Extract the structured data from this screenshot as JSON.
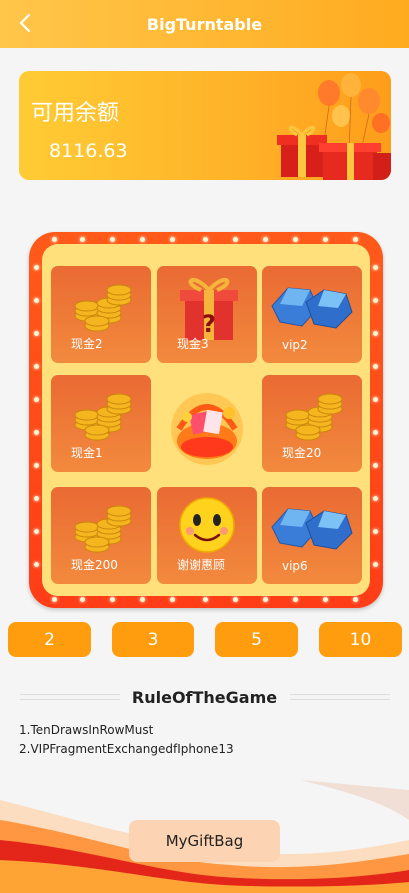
{
  "header": {
    "title": "BigTurntable",
    "back_icon": "chevron-left-icon"
  },
  "balance": {
    "label": "可用余额",
    "value": "8116.63"
  },
  "prizes": [
    {
      "label": "现金2",
      "icon": "gold-coins-icon"
    },
    {
      "label": "现金3",
      "icon": "mystery-gift-icon"
    },
    {
      "label": "vip2",
      "icon": "blue-diamond-icon"
    },
    {
      "label": "现金1",
      "icon": "gold-coins-icon"
    },
    {
      "label": "现金20",
      "icon": "gold-coins-icon"
    },
    {
      "label": "现金200",
      "icon": "gold-coins-icon"
    },
    {
      "label": "谢谢惠顾",
      "icon": "smiley-face-icon"
    },
    {
      "label": "vip6",
      "icon": "blue-diamond-icon"
    }
  ],
  "center": {
    "icon": "gift-basket-icon"
  },
  "draw_counts": [
    "2",
    "3",
    "5",
    "10"
  ],
  "rules": {
    "title": "RuleOfTheGame",
    "items": [
      "1.TenDrawsInRowMust",
      "2.VIPFragmentExchangedfIphone13"
    ]
  },
  "footer": {
    "gift_bag_label": "MyGiftBag"
  },
  "colors": {
    "accent": "#ff9d0f",
    "wheel_frame": "#ff4a18",
    "cell": "#ea6a33",
    "wheel_bg": "#ffe07a"
  }
}
